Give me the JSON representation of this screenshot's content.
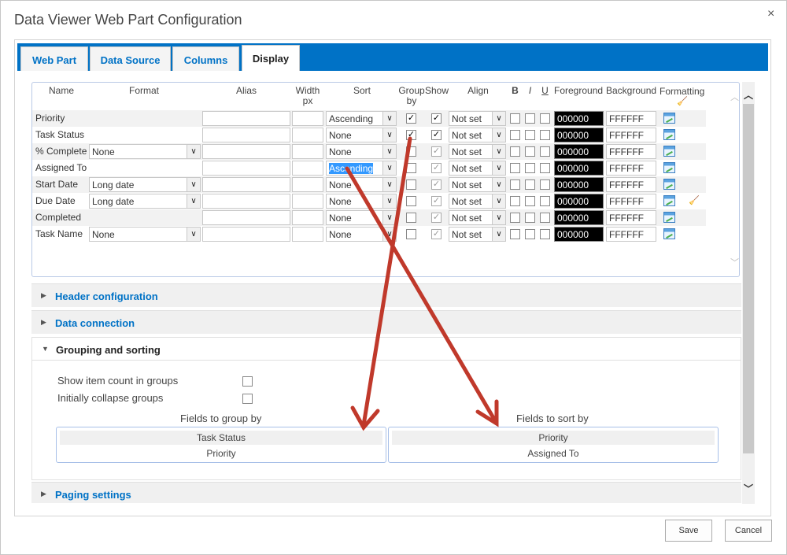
{
  "dialog": {
    "title": "Data Viewer Web Part Configuration",
    "close": "×"
  },
  "tabs": [
    {
      "label": "Web Part"
    },
    {
      "label": "Data Source"
    },
    {
      "label": "Columns"
    },
    {
      "label": "Display",
      "active": true
    }
  ],
  "grid": {
    "headers": {
      "name": "Name",
      "format": "Format",
      "alias": "Alias",
      "width": "Width\npx",
      "sort": "Sort",
      "group": "Group\nby",
      "show": "Show",
      "align": "Align",
      "b": "B",
      "i": "I",
      "u": "U",
      "fg": "Foreground",
      "bg": "Background",
      "formatting": "Formatting"
    },
    "rows": [
      {
        "name": "Priority",
        "format": null,
        "alias": "",
        "width": "",
        "sort": "Ascending",
        "group": true,
        "show": true,
        "showDisabled": false,
        "align": "Not set",
        "fg": "000000",
        "bg": "FFFFFF",
        "broom": false
      },
      {
        "name": "Task Status",
        "format": null,
        "alias": "",
        "width": "",
        "sort": "None",
        "group": true,
        "show": true,
        "showDisabled": false,
        "align": "Not set",
        "fg": "000000",
        "bg": "FFFFFF",
        "broom": false
      },
      {
        "name": "% Complete",
        "format": "None",
        "alias": "",
        "width": "",
        "sort": "None",
        "group": false,
        "show": true,
        "showDisabled": true,
        "align": "Not set",
        "fg": "000000",
        "bg": "FFFFFF",
        "broom": false
      },
      {
        "name": "Assigned To",
        "format": null,
        "alias": "",
        "width": "",
        "sort": "Ascending",
        "sortFocused": true,
        "group": false,
        "show": true,
        "showDisabled": true,
        "align": "Not set",
        "fg": "000000",
        "bg": "FFFFFF",
        "broom": false
      },
      {
        "name": "Start Date",
        "format": "Long date",
        "alias": "",
        "width": "",
        "sort": "None",
        "group": false,
        "show": true,
        "showDisabled": true,
        "align": "Not set",
        "fg": "000000",
        "bg": "FFFFFF",
        "broom": false
      },
      {
        "name": "Due Date",
        "format": "Long date",
        "alias": "",
        "width": "",
        "sort": "None",
        "group": false,
        "show": true,
        "showDisabled": true,
        "align": "Not set",
        "fg": "000000",
        "bg": "FFFFFF",
        "broom": true
      },
      {
        "name": "Completed",
        "format": null,
        "alias": "",
        "width": "",
        "sort": "None",
        "group": false,
        "show": true,
        "showDisabled": true,
        "align": "Not set",
        "fg": "000000",
        "bg": "FFFFFF",
        "broom": false
      },
      {
        "name": "Task Name",
        "format": "None",
        "alias": "",
        "width": "",
        "sort": "None",
        "group": false,
        "show": true,
        "showDisabled": true,
        "align": "Not set",
        "fg": "000000",
        "bg": "FFFFFF",
        "broom": false
      }
    ]
  },
  "sections": {
    "header": "Header configuration",
    "data": "Data connection",
    "grouping": "Grouping and sorting",
    "paging": "Paging settings"
  },
  "grouping": {
    "show_count": "Show item count in groups",
    "collapse": "Initially collapse groups",
    "group_title": "Fields to group by",
    "group_fields": [
      "Task Status",
      "Priority"
    ],
    "sort_title": "Fields to sort by",
    "sort_fields": [
      "Priority",
      "Assigned To"
    ]
  },
  "buttons": {
    "save": "Save",
    "cancel": "Cancel"
  },
  "colors": {
    "accent": "#0072c6",
    "annotation": "#c0392b"
  }
}
